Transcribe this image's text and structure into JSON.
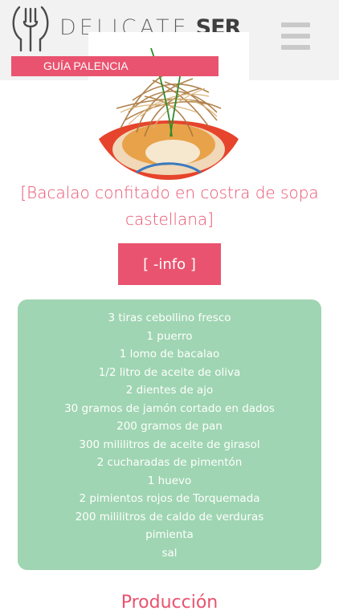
{
  "header": {
    "brand_thin": "DELICATE",
    "brand_bold": "SER",
    "guide_label": "GUÍA PALENCIA",
    "menu_icon": "hamburger-menu-icon",
    "logo_icon": "fork-spoon-logo-icon"
  },
  "recipe": {
    "title": "[Bacalao confitado en costra de sopa castellana]",
    "info_button_label": "[ -info ]",
    "ingredients": [
      "3 tiras cebollino fresco",
      "1 puerro",
      "1 lomo de bacalao",
      "1/2 litro de aceite de oliva",
      "2 dientes de ajo",
      "30 gramos de jamón cortado en dados",
      "200 gramos de pan",
      "300 mililitros de aceite de girasol",
      "2 cucharadas de pimentón",
      "1 huevo",
      "2 pimientos rojos de Torquemada",
      "200 mililitros de caldo de verduras",
      "pimienta",
      "sal"
    ]
  },
  "next_heading": "Producción",
  "colors": {
    "accent": "#e9536f",
    "ingredients_bg": "#9fd5b2",
    "header_bg": "#f2f2f2"
  }
}
